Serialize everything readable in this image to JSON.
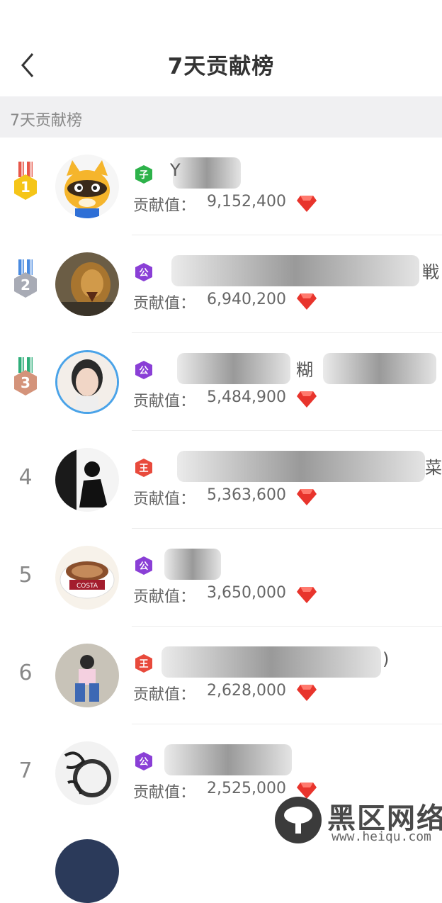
{
  "header": {
    "title": "7天贡献榜"
  },
  "section": {
    "label": "7天贡献榜"
  },
  "contrib_label": "贡献值：",
  "rows": [
    {
      "rank": "1",
      "badge": "子",
      "badge_color": "#2db24a",
      "name": "Y",
      "value": "9,152,400"
    },
    {
      "rank": "2",
      "badge": "公",
      "badge_color": "#8a3fd6",
      "name": "戦",
      "value": "6,940,200"
    },
    {
      "rank": "3",
      "badge": "公",
      "badge_color": "#8a3fd6",
      "name": "糊",
      "value": "5,484,900"
    },
    {
      "rank": "4",
      "badge": "王",
      "badge_color": "#e84a3c",
      "name": "菜",
      "value": "5,363,600"
    },
    {
      "rank": "5",
      "badge": "公",
      "badge_color": "#8a3fd6",
      "name": "",
      "value": "3,650,000"
    },
    {
      "rank": "6",
      "badge": "王",
      "badge_color": "#e84a3c",
      "name": ")",
      "value": "2,628,000"
    },
    {
      "rank": "7",
      "badge": "公",
      "badge_color": "#8a3fd6",
      "name": "",
      "value": "2,525,000"
    }
  ],
  "watermark": {
    "text": "黑区网络",
    "url": "www.heiqu.com"
  },
  "colors": {
    "gem": "#e8342c",
    "gold": "#f5c518",
    "silver": "#a8abb5",
    "bronze": "#d4937a"
  }
}
